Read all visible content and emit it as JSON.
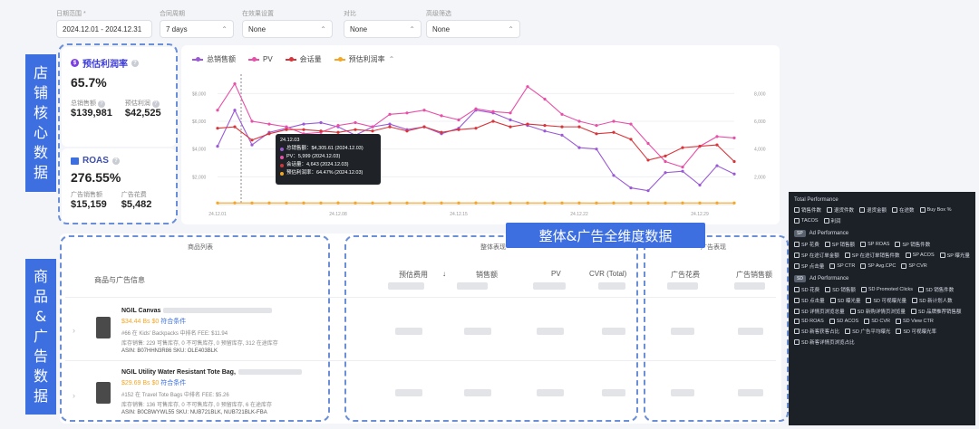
{
  "filters": [
    {
      "label": "日期范围 *",
      "value": "2024.12.01 - 2024.12.31"
    },
    {
      "label": "合同周期",
      "value": "7 days"
    },
    {
      "label": "在效果设置",
      "value": "None"
    },
    {
      "label": "对比",
      "value": "None"
    },
    {
      "label": "高级筛选",
      "value": "None"
    }
  ],
  "kpi": {
    "profit_title": "预估利润率",
    "profit_value": "65.7%",
    "total_sales_label": "总销售额",
    "total_sales_value": "$139,981",
    "est_profit_label": "预估利润",
    "est_profit_value": "$42,525",
    "roas_title": "ROAS",
    "roas_value": "276.55%",
    "ad_sales_label": "广告销售额",
    "ad_sales_value": "$15,159",
    "ad_spend_label": "广告花费",
    "ad_spend_value": "$5,482"
  },
  "side_labels": {
    "store": [
      "店",
      "铺",
      "核",
      "心",
      "数",
      "据"
    ],
    "product": [
      "商",
      "品",
      "&",
      "广",
      "告",
      "数",
      "据"
    ]
  },
  "banner": "整体&广告全维度数据",
  "colors": {
    "total_sales": "#9b59d6",
    "pv": "#e84fa8",
    "sessions": "#d9343a",
    "profit_rate": "#f5a623",
    "accent": "#3d6fe0"
  },
  "chart_data": {
    "type": "line",
    "x": [
      "24.12.01",
      "24.12.02",
      "24.12.03",
      "24.12.04",
      "24.12.05",
      "24.12.06",
      "24.12.07",
      "24.12.08",
      "24.12.09",
      "24.12.10",
      "24.12.11",
      "24.12.12",
      "24.12.13",
      "24.12.14",
      "24.12.15",
      "24.12.16",
      "24.12.17",
      "24.12.18",
      "24.12.19",
      "24.12.20",
      "24.12.21",
      "24.12.22",
      "24.12.23",
      "24.12.24",
      "24.12.25",
      "24.12.26",
      "24.12.27",
      "24.12.28",
      "24.12.29",
      "24.12.30",
      "24.12.31"
    ],
    "xticks": [
      "24.12.01",
      "24.12.08",
      "24.12.15",
      "24.12.22",
      "24.12.29"
    ],
    "yticks_left": [
      "$2,000",
      "$4,000",
      "$6,000",
      "$8,000"
    ],
    "yticks_right": [
      "2,000",
      "4,000",
      "6,000",
      "8,000"
    ],
    "ylim": [
      0,
      9000
    ],
    "series": [
      {
        "name": "总销售额",
        "values": [
          4200,
          6800,
          4300,
          5200,
          5500,
          5800,
          5900,
          5600,
          5000,
          5600,
          5800,
          5400,
          5600,
          5100,
          5500,
          6800,
          6600,
          6100,
          5700,
          5300,
          5000,
          4100,
          4000,
          2100,
          1200,
          1000,
          2300,
          2400,
          1400,
          2800,
          2200
        ]
      },
      {
        "name": "PV",
        "values": [
          6800,
          8700,
          5999,
          5800,
          5600,
          5100,
          5200,
          5700,
          5900,
          5600,
          6500,
          6600,
          6800,
          6400,
          6100,
          6900,
          6700,
          6600,
          8500,
          7600,
          6500,
          6000,
          5700,
          6000,
          5800,
          4400,
          3100,
          2700,
          4200,
          4900,
          4800
        ]
      },
      {
        "name": "会话量",
        "values": [
          5500,
          5600,
          4643,
          5100,
          5400,
          5400,
          5300,
          5200,
          5400,
          5300,
          5600,
          5300,
          5600,
          5200,
          5400,
          5500,
          6000,
          5600,
          5800,
          5700,
          5600,
          5600,
          5100,
          5200,
          4700,
          3200,
          3500,
          4100,
          4200,
          4300,
          3100
        ]
      },
      {
        "name": "预估利润率",
        "values": [
          64.5,
          64.7,
          64.5,
          64.6,
          64.6,
          64.5,
          64.6,
          64.7,
          64.5,
          64.4,
          64.6,
          64.5,
          64.6,
          64.5,
          64.6,
          64.7,
          64.6,
          64.5,
          64.6,
          64.5,
          64.6,
          64.5,
          64.4,
          64.6,
          64.5,
          64.6,
          64.5,
          64.6,
          64.5,
          64.6,
          64.5
        ]
      }
    ],
    "tooltip": {
      "date": "24.12.03",
      "rows": [
        "总销售额：$4,305.61 (2024.12.03)",
        "PV：5,999 (2024.12.03)",
        "会话量：4,643 (2024.12.03)",
        "预估利润率：64.47% (2024.12.03)"
      ]
    }
  },
  "tables": {
    "product_title": "商品列表",
    "product_col": "商品与广告信息",
    "overall_title": "整体表现",
    "overall_cols": [
      "预估费用",
      "销售额",
      "PV",
      "CVR (Total)"
    ],
    "ad_title": "广告表现",
    "ad_cols": [
      "广告花费",
      "广告销售额"
    ]
  },
  "products": [
    {
      "name": "NGIL Canvas",
      "price": "$34.44",
      "bs": "Bs $0",
      "link": "符合条件",
      "line1": "#66 在 Kids' Backpacks 中排名   FEE: $11.94",
      "line2": "库存销售: 229 可售库存, 0 不可售库存, 0 预留库存, 312 在途库存",
      "line3": "ASIN: B07HHN3R86   SKU: OLE403BLK"
    },
    {
      "name": "NGIL Utility Water Resistant Tote Bag,",
      "price": "$29.69",
      "bs": "Bs $0",
      "link": "符合条件",
      "line1": "#152 在 Travel Tote Bags 中排名   FEE: $5.26",
      "line2": "库存销售: 136 可售库存, 0 不可售库存, 0 预留库存, 6 在途库存",
      "line3": "ASIN: B0CBWYWL55   SKU: NUB721BLK, NUB721BLK-FBA"
    }
  ],
  "perf": {
    "total_title": "Total Performance",
    "total_items": [
      "销售件数",
      "退货件数",
      "退货金额",
      "在途数",
      "Buy Box %",
      "TACOS",
      "利润"
    ],
    "sp_title": "Ad Performance",
    "sp_tag": "SP",
    "sp_items": [
      "SP 花费",
      "SP 销售额",
      "SP ROAS",
      "SP 销售件数",
      "SP 在途订单金额",
      "SP 在途订单销售件数",
      "SP ACOS",
      "SP 曝光量",
      "SP 点击量",
      "SP CTR",
      "SP Avg.CPC",
      "SP CVR"
    ],
    "sd_title": "Ad Performance",
    "sd_tag": "SD",
    "sd_items": [
      "SD 花费",
      "SD 销售额",
      "SD Promoted Clicks",
      "SD 销售件数",
      "SD 点击量",
      "SD 曝光量",
      "SD 可视曝光量",
      "SD 新计划人数",
      "SD 详情页浏览总量",
      "SD 新购详情页浏览量",
      "SD 品牌推荐销售额",
      "SD ROAS",
      "SD ACOS",
      "SD CVR",
      "SD View CTR",
      "SD 新客获客占比",
      "SD 广告平均曝光",
      "SD 可视曝光率",
      "SD 新客详情页浏览占比"
    ]
  }
}
